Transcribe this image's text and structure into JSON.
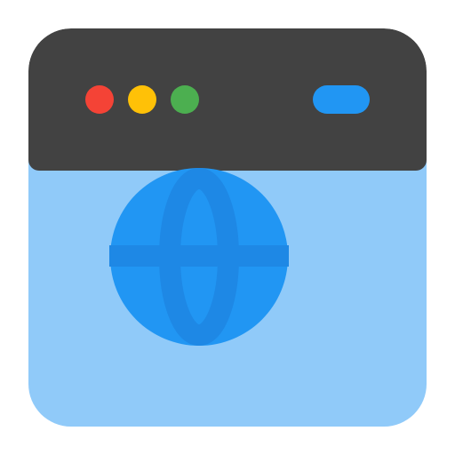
{
  "icon": {
    "name": "browser-globe-icon",
    "colors": {
      "titlebar": "#424242",
      "content": "#90caf9",
      "dot_red": "#f44336",
      "dot_yellow": "#ffc107",
      "dot_green": "#4caf50",
      "pill": "#2196f3",
      "globe": "#2196f3",
      "globe_lines": "#1e88e5"
    }
  }
}
